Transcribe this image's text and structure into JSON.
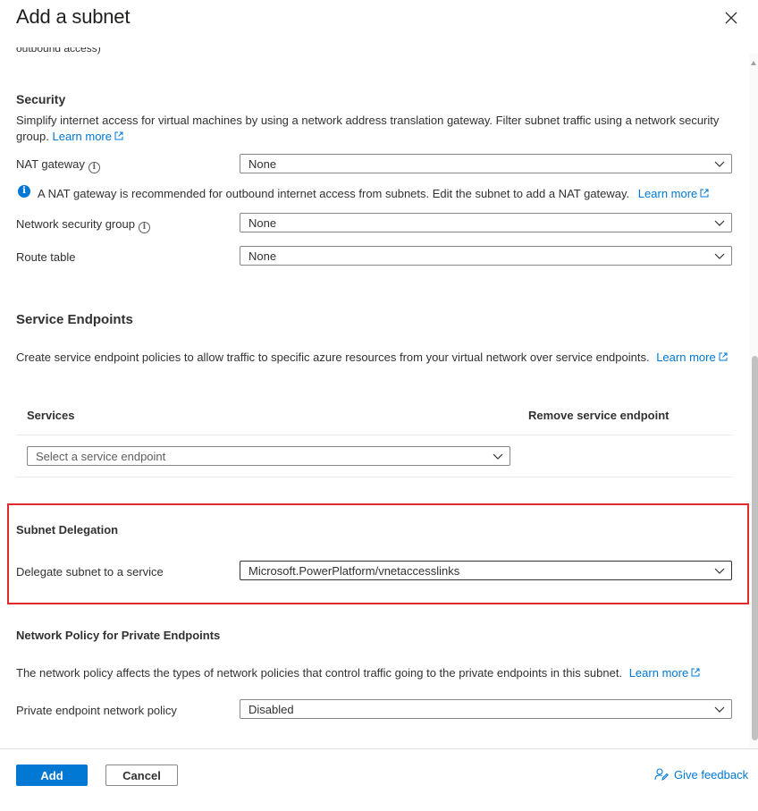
{
  "header": {
    "title": "Add a subnet",
    "close_icon": "close-icon"
  },
  "cutoff_text": "outbound access)",
  "security": {
    "heading": "Security",
    "description": "Simplify internet access for virtual machines by using a network address translation gateway. Filter subnet traffic using a network security group.",
    "learn_more": "Learn more",
    "nat_gateway": {
      "label": "NAT gateway",
      "value": "None"
    },
    "nat_info": "A NAT gateway is recommended for outbound internet access from subnets. Edit the subnet to add a NAT gateway.",
    "nat_info_link": "Learn more",
    "nsg": {
      "label": "Network security group",
      "value": "None"
    },
    "route_table": {
      "label": "Route table",
      "value": "None"
    }
  },
  "service_endpoints": {
    "heading": "Service Endpoints",
    "description": "Create service endpoint policies to allow traffic to specific azure resources from your virtual network over service endpoints.",
    "learn_more": "Learn more",
    "columns": {
      "services": "Services",
      "remove": "Remove service endpoint"
    },
    "select_placeholder": "Select a service endpoint"
  },
  "delegation": {
    "heading": "Subnet Delegation",
    "label": "Delegate subnet to a service",
    "value": "Microsoft.PowerPlatform/vnetaccesslinks"
  },
  "network_policy": {
    "heading": "Network Policy for Private Endpoints",
    "description": "The network policy affects the types of network policies that control traffic going to the private endpoints in this subnet.",
    "learn_more": "Learn more",
    "label": "Private endpoint network policy",
    "value": "Disabled"
  },
  "footer": {
    "add_label": "Add",
    "cancel_label": "Cancel",
    "feedback_label": "Give feedback"
  },
  "colors": {
    "accent": "#0078d4",
    "highlight": "#e22a2a"
  }
}
